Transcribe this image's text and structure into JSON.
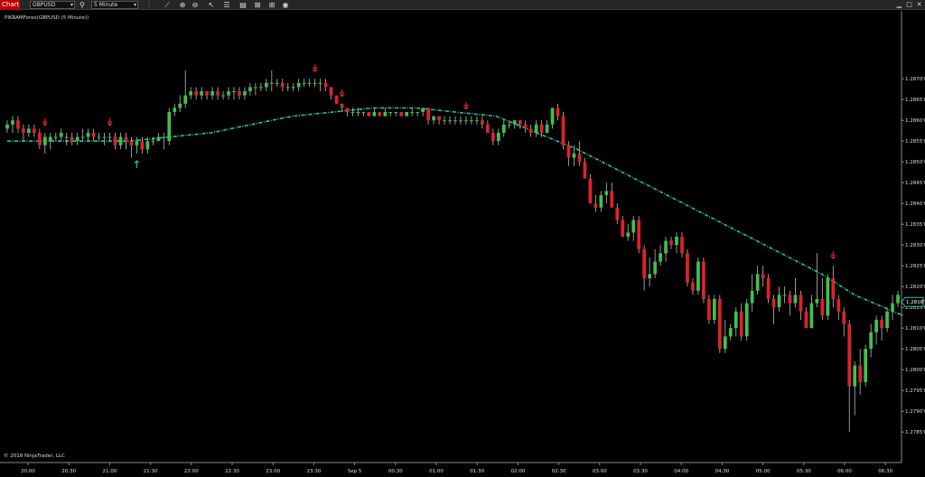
{
  "toolbar": {
    "chart_label": "Chart",
    "instrument": "GBPUSD",
    "interval": "5 Minute",
    "icons": [
      "bar-type-icon",
      "draw-tool-icon",
      "zoom-in-icon",
      "zoom-out-icon",
      "cursor-icon",
      "properties-icon",
      "strategies-icon",
      "attach-icon",
      "data-box-icon",
      "tab-add-icon"
    ],
    "window_controls": [
      "minimize-icon",
      "maximize-icon",
      "close-icon"
    ]
  },
  "chart_label": "PIKRAMForex(GBPUSD (5 Minute))",
  "copyright": "© 2018 NinjaTrader, LLC",
  "colors": {
    "background": "#000000",
    "up": "#3fc24a",
    "down": "#e0212b",
    "ma": "#18c8a8",
    "arrow_up": "#3fc24a",
    "arrow_down": "#e0212b",
    "price_tag": "#22c6a6"
  },
  "chart_data": {
    "type": "candlestick",
    "instrument": "GBPUSD",
    "interval": "5 Minute",
    "time_labels": [
      "20:00",
      "20:30",
      "21:00",
      "21:30",
      "22:00",
      "22:30",
      "23:00",
      "23:30",
      "Sep 5",
      "00:30",
      "01:00",
      "01:30",
      "02:00",
      "02:30",
      "03:00",
      "03:30",
      "04:00",
      "04:30",
      "05:00",
      "05:30",
      "06:00",
      "06:30"
    ],
    "ylim": [
      1.2782,
      1.2882
    ],
    "y_ticks": [
      "1.2870'0",
      "1.2865'0",
      "1.2860'0",
      "1.2855'0",
      "1.2850'0",
      "1.2845'0",
      "1.2840'0",
      "1.2835'0",
      "1.2830'0",
      "1.2825'0",
      "1.2820'0",
      "1.2815'0",
      "1.2810'0",
      "1.2805'0",
      "1.2800'0",
      "1.2795'0",
      "1.2790'0",
      "1.2785'0"
    ],
    "current_price": 1.28163,
    "current_price_label": "1.2816'3",
    "ma_series": [
      [
        0,
        1.2855
      ],
      [
        30,
        1.2855
      ],
      [
        40,
        1.2856
      ],
      [
        50,
        1.2857
      ],
      [
        60,
        1.2859
      ],
      [
        70,
        1.2861
      ],
      [
        80,
        1.2862
      ],
      [
        90,
        1.2863
      ],
      [
        100,
        1.2863
      ],
      [
        110,
        1.2862
      ],
      [
        120,
        1.2861
      ],
      [
        130,
        1.2857
      ],
      [
        140,
        1.2853
      ],
      [
        150,
        1.2848
      ],
      [
        160,
        1.2843
      ],
      [
        170,
        1.2838
      ],
      [
        180,
        1.2833
      ],
      [
        190,
        1.2828
      ],
      [
        200,
        1.2823
      ],
      [
        208,
        1.2818
      ],
      [
        220,
        1.2813
      ]
    ],
    "candles": [
      [
        0,
        1.2858,
        1.2859,
        1.2857,
        1.286
      ],
      [
        1,
        1.2859,
        1.286,
        1.2857,
        1.2861
      ],
      [
        2,
        1.286,
        1.2858,
        1.2857,
        1.2861
      ],
      [
        3,
        1.2858,
        1.2857,
        1.2855,
        1.2859
      ],
      [
        4,
        1.2857,
        1.2858,
        1.2856,
        1.2859
      ],
      [
        5,
        1.2858,
        1.2857,
        1.2856,
        1.2859
      ],
      [
        6,
        1.2857,
        1.2854,
        1.2853,
        1.2858
      ],
      [
        7,
        1.2854,
        1.2856,
        1.2852,
        1.2857
      ],
      [
        8,
        1.2855,
        1.2856,
        1.2853,
        1.2857
      ],
      [
        9,
        1.2856,
        1.2856,
        1.2855,
        1.2857
      ],
      [
        10,
        1.2856,
        1.2857,
        1.2855,
        1.2858
      ],
      [
        11,
        1.2856,
        1.2856,
        1.2854,
        1.2857
      ],
      [
        12,
        1.2856,
        1.2855,
        1.2854,
        1.2857
      ],
      [
        13,
        1.2855,
        1.2856,
        1.2854,
        1.2857
      ],
      [
        14,
        1.2856,
        1.2856,
        1.2855,
        1.2858
      ],
      [
        15,
        1.2856,
        1.2857,
        1.2855,
        1.2858
      ],
      [
        16,
        1.2857,
        1.2856,
        1.2855,
        1.2858
      ],
      [
        17,
        1.2856,
        1.2856,
        1.2855,
        1.2857
      ],
      [
        18,
        1.2856,
        1.2856,
        1.2854,
        1.2857
      ],
      [
        19,
        1.2856,
        1.2856,
        1.2855,
        1.2857
      ],
      [
        20,
        1.2856,
        1.2854,
        1.2853,
        1.2857
      ],
      [
        21,
        1.2854,
        1.2856,
        1.2853,
        1.2857
      ],
      [
        22,
        1.2856,
        1.2855,
        1.2853,
        1.2857
      ],
      [
        23,
        1.2855,
        1.2854,
        1.2851,
        1.2856
      ],
      [
        24,
        1.2854,
        1.2855,
        1.2852,
        1.2856
      ],
      [
        25,
        1.2855,
        1.2853,
        1.2852,
        1.2856
      ],
      [
        26,
        1.2853,
        1.2855,
        1.2852,
        1.2856
      ],
      [
        27,
        1.2855,
        1.2855,
        1.2854,
        1.2856
      ],
      [
        28,
        1.2855,
        1.2856,
        1.2855,
        1.2857
      ],
      [
        29,
        1.2856,
        1.2856,
        1.2853,
        1.2857
      ],
      [
        30,
        1.2855,
        1.2862,
        1.2854,
        1.2863
      ],
      [
        31,
        1.2862,
        1.2863,
        1.2861,
        1.2864
      ],
      [
        32,
        1.2863,
        1.2864,
        1.2862,
        1.2866
      ],
      [
        33,
        1.2864,
        1.2866,
        1.2863,
        1.2872
      ],
      [
        34,
        1.2866,
        1.2867,
        1.2865,
        1.2868
      ],
      [
        35,
        1.2867,
        1.2866,
        1.2865,
        1.2868
      ],
      [
        36,
        1.2866,
        1.2867,
        1.2865,
        1.2868
      ],
      [
        37,
        1.2867,
        1.2866,
        1.2865,
        1.2867
      ],
      [
        38,
        1.2866,
        1.2867,
        1.2865,
        1.2868
      ],
      [
        39,
        1.2867,
        1.2866,
        1.2865,
        1.2868
      ],
      [
        40,
        1.2866,
        1.2866,
        1.2865,
        1.2867
      ],
      [
        41,
        1.2866,
        1.2867,
        1.2865,
        1.2868
      ],
      [
        42,
        1.2867,
        1.2867,
        1.2865,
        1.2868
      ],
      [
        43,
        1.2867,
        1.2866,
        1.2865,
        1.2868
      ],
      [
        44,
        1.2866,
        1.2867,
        1.2865,
        1.2868
      ],
      [
        45,
        1.2867,
        1.2868,
        1.2866,
        1.2869
      ],
      [
        46,
        1.2868,
        1.2868,
        1.2866,
        1.2869
      ],
      [
        47,
        1.2868,
        1.2868,
        1.2867,
        1.2869
      ],
      [
        48,
        1.2868,
        1.2869,
        1.2867,
        1.287
      ],
      [
        49,
        1.2869,
        1.2869,
        1.2867,
        1.2872
      ],
      [
        50,
        1.2869,
        1.2869,
        1.2868,
        1.287
      ],
      [
        51,
        1.2869,
        1.2868,
        1.2867,
        1.287
      ],
      [
        52,
        1.2868,
        1.2868,
        1.2867,
        1.2869
      ],
      [
        53,
        1.2868,
        1.2868,
        1.2867,
        1.2869
      ],
      [
        54,
        1.2868,
        1.2869,
        1.2867,
        1.287
      ],
      [
        55,
        1.2869,
        1.2869,
        1.2868,
        1.287
      ],
      [
        56,
        1.2869,
        1.2869,
        1.2868,
        1.287
      ],
      [
        57,
        1.2869,
        1.2869,
        1.2868,
        1.287
      ],
      [
        58,
        1.2869,
        1.2869,
        1.2867,
        1.287
      ],
      [
        59,
        1.2869,
        1.2868,
        1.2867,
        1.287
      ],
      [
        60,
        1.2868,
        1.2866,
        1.2865,
        1.2868
      ],
      [
        61,
        1.2866,
        1.2864,
        1.2864,
        1.2866
      ],
      [
        62,
        1.2864,
        1.2863,
        1.2862,
        1.2864
      ],
      [
        63,
        1.2863,
        1.2862,
        1.2861,
        1.2863
      ],
      [
        64,
        1.2862,
        1.2862,
        1.2861,
        1.2863
      ],
      [
        65,
        1.2862,
        1.2862,
        1.2861,
        1.2863
      ],
      [
        66,
        1.2862,
        1.2862,
        1.2861,
        1.2862
      ],
      [
        67,
        1.2862,
        1.2861,
        1.2861,
        1.2862
      ],
      [
        68,
        1.2861,
        1.2862,
        1.2861,
        1.2863
      ],
      [
        69,
        1.2862,
        1.2861,
        1.2861,
        1.2862
      ],
      [
        70,
        1.2861,
        1.2862,
        1.2861,
        1.2863
      ],
      [
        71,
        1.2862,
        1.2862,
        1.2861,
        1.2862
      ],
      [
        72,
        1.2862,
        1.2862,
        1.2861,
        1.2862
      ],
      [
        73,
        1.2862,
        1.2861,
        1.2861,
        1.2862
      ],
      [
        74,
        1.2861,
        1.2862,
        1.2861,
        1.2862
      ],
      [
        75,
        1.2862,
        1.2862,
        1.2861,
        1.2863
      ],
      [
        76,
        1.2862,
        1.2862,
        1.2861,
        1.2862
      ],
      [
        77,
        1.2862,
        1.2863,
        1.2861,
        1.2863
      ],
      [
        78,
        1.2863,
        1.286,
        1.2859,
        1.2863
      ],
      [
        79,
        1.286,
        1.2861,
        1.2859,
        1.2861
      ],
      [
        80,
        1.2861,
        1.286,
        1.2859,
        1.2861
      ],
      [
        81,
        1.286,
        1.286,
        1.2859,
        1.2861
      ],
      [
        82,
        1.286,
        1.286,
        1.2859,
        1.2861
      ],
      [
        83,
        1.286,
        1.286,
        1.2859,
        1.2861
      ],
      [
        84,
        1.286,
        1.286,
        1.2859,
        1.2861
      ],
      [
        85,
        1.286,
        1.286,
        1.2859,
        1.2861
      ],
      [
        86,
        1.286,
        1.286,
        1.2859,
        1.2861
      ],
      [
        87,
        1.286,
        1.286,
        1.2859,
        1.2861
      ],
      [
        88,
        1.286,
        1.2859,
        1.2858,
        1.2861
      ],
      [
        89,
        1.2859,
        1.2857,
        1.2857,
        1.286
      ],
      [
        90,
        1.2857,
        1.2855,
        1.2854,
        1.2858
      ],
      [
        91,
        1.2855,
        1.2857,
        1.2854,
        1.2858
      ],
      [
        92,
        1.2857,
        1.2859,
        1.2856,
        1.286
      ],
      [
        93,
        1.2859,
        1.2859,
        1.2858,
        1.286
      ],
      [
        94,
        1.2859,
        1.286,
        1.2858,
        1.286
      ],
      [
        95,
        1.286,
        1.2859,
        1.2858,
        1.286
      ],
      [
        96,
        1.2859,
        1.2858,
        1.2857,
        1.286
      ],
      [
        97,
        1.2858,
        1.2857,
        1.2856,
        1.2859
      ],
      [
        98,
        1.2857,
        1.2859,
        1.2856,
        1.286
      ],
      [
        99,
        1.2859,
        1.2857,
        1.2856,
        1.286
      ],
      [
        100,
        1.2857,
        1.2859,
        1.2857,
        1.286
      ],
      [
        101,
        1.2859,
        1.2863,
        1.2858,
        1.2863
      ],
      [
        102,
        1.2863,
        1.2861,
        1.286,
        1.2864
      ],
      [
        103,
        1.2861,
        1.2854,
        1.2853,
        1.2862
      ],
      [
        104,
        1.2854,
        1.2851,
        1.2849,
        1.2855
      ],
      [
        105,
        1.2851,
        1.2852,
        1.2849,
        1.2854
      ],
      [
        106,
        1.2852,
        1.285,
        1.2849,
        1.2855
      ],
      [
        107,
        1.285,
        1.2846,
        1.2846,
        1.2851
      ],
      [
        108,
        1.2846,
        1.284,
        1.284,
        1.2847
      ],
      [
        109,
        1.284,
        1.2839,
        1.2838,
        1.2842
      ],
      [
        110,
        1.2839,
        1.2842,
        1.2838,
        1.2843
      ],
      [
        111,
        1.2842,
        1.2843,
        1.284,
        1.2845
      ],
      [
        112,
        1.2843,
        1.2839,
        1.2839,
        1.2845
      ],
      [
        113,
        1.2839,
        1.2836,
        1.2835,
        1.284
      ],
      [
        114,
        1.2836,
        1.2832,
        1.2832,
        1.2837
      ],
      [
        115,
        1.2832,
        1.2833,
        1.2831,
        1.2835
      ],
      [
        116,
        1.2833,
        1.2836,
        1.2831,
        1.2837
      ],
      [
        117,
        1.2836,
        1.2829,
        1.2828,
        1.2837
      ],
      [
        118,
        1.2829,
        1.2822,
        1.2819,
        1.283
      ],
      [
        119,
        1.2822,
        1.2823,
        1.282,
        1.2827
      ],
      [
        120,
        1.2823,
        1.2826,
        1.2822,
        1.2829
      ],
      [
        121,
        1.2826,
        1.2828,
        1.2825,
        1.283
      ],
      [
        122,
        1.2828,
        1.2831,
        1.2826,
        1.2832
      ],
      [
        123,
        1.2831,
        1.283,
        1.2829,
        1.2832
      ],
      [
        124,
        1.283,
        1.2832,
        1.2828,
        1.2833
      ],
      [
        125,
        1.2832,
        1.2828,
        1.2827,
        1.2833
      ],
      [
        126,
        1.2828,
        1.2821,
        1.282,
        1.2829
      ],
      [
        127,
        1.2821,
        1.2819,
        1.2818,
        1.2822
      ],
      [
        128,
        1.2819,
        1.2826,
        1.2818,
        1.2827
      ],
      [
        129,
        1.2826,
        1.2817,
        1.2816,
        1.2827
      ],
      [
        130,
        1.2817,
        1.2812,
        1.2811,
        1.2818
      ],
      [
        131,
        1.2812,
        1.2817,
        1.2811,
        1.2818
      ],
      [
        132,
        1.2817,
        1.2805,
        1.2804,
        1.2818
      ],
      [
        133,
        1.2805,
        1.2808,
        1.2804,
        1.2812
      ],
      [
        134,
        1.2808,
        1.281,
        1.2807,
        1.2811
      ],
      [
        135,
        1.281,
        1.2814,
        1.2808,
        1.2815
      ],
      [
        136,
        1.2814,
        1.2808,
        1.2807,
        1.2816
      ],
      [
        137,
        1.2808,
        1.2816,
        1.2807,
        1.2817
      ],
      [
        138,
        1.2816,
        1.2819,
        1.2814,
        1.2823
      ],
      [
        139,
        1.2819,
        1.2823,
        1.2818,
        1.2825
      ],
      [
        140,
        1.2823,
        1.2822,
        1.282,
        1.2825
      ],
      [
        141,
        1.2822,
        1.2817,
        1.2816,
        1.2823
      ],
      [
        142,
        1.2817,
        1.2815,
        1.2811,
        1.2818
      ],
      [
        143,
        1.2815,
        1.2818,
        1.2814,
        1.282
      ],
      [
        144,
        1.2818,
        1.2818,
        1.2816,
        1.282
      ],
      [
        145,
        1.2818,
        1.2816,
        1.2813,
        1.2819
      ],
      [
        146,
        1.2816,
        1.2818,
        1.2815,
        1.2822
      ],
      [
        147,
        1.2818,
        1.2814,
        1.2812,
        1.2819
      ],
      [
        148,
        1.2814,
        1.281,
        1.281,
        1.2815
      ],
      [
        149,
        1.281,
        1.2816,
        1.281,
        1.2818
      ],
      [
        150,
        1.2816,
        1.2817,
        1.2815,
        1.2828
      ],
      [
        151,
        1.2817,
        1.2813,
        1.2812,
        1.2822
      ],
      [
        152,
        1.2813,
        1.2822,
        1.2812,
        1.2823
      ],
      [
        153,
        1.2822,
        1.2817,
        1.2815,
        1.2825
      ],
      [
        154,
        1.2817,
        1.2814,
        1.2812,
        1.2818
      ],
      [
        155,
        1.2814,
        1.2811,
        1.2808,
        1.2815
      ],
      [
        156,
        1.2811,
        1.2796,
        1.2785,
        1.2812
      ],
      [
        157,
        1.2796,
        1.2801,
        1.2789,
        1.2802
      ],
      [
        158,
        1.2801,
        1.2797,
        1.2794,
        1.2805
      ],
      [
        159,
        1.2797,
        1.2805,
        1.2796,
        1.2806
      ],
      [
        160,
        1.2805,
        1.2809,
        1.2803,
        1.2811
      ],
      [
        161,
        1.2809,
        1.2812,
        1.2806,
        1.2813
      ],
      [
        162,
        1.2812,
        1.281,
        1.2807,
        1.2813
      ],
      [
        163,
        1.281,
        1.2814,
        1.2809,
        1.2815
      ],
      [
        164,
        1.2814,
        1.2816,
        1.2812,
        1.2818
      ],
      [
        165,
        1.2816,
        1.2818,
        1.2815,
        1.2819
      ]
    ],
    "arrows": [
      {
        "i": 7,
        "dir": "down"
      },
      {
        "i": 19,
        "dir": "down"
      },
      {
        "i": 24,
        "dir": "up"
      },
      {
        "i": 57,
        "dir": "down"
      },
      {
        "i": 62,
        "dir": "down"
      },
      {
        "i": 85,
        "dir": "down"
      },
      {
        "i": 153,
        "dir": "down"
      }
    ]
  }
}
